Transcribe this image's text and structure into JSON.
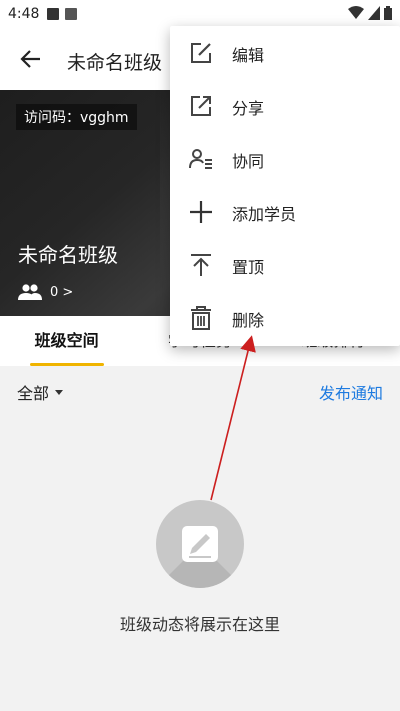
{
  "status_bar": {
    "time": "4:48"
  },
  "header": {
    "title": "未命名班级"
  },
  "banner": {
    "access_code": "访问码：vgghm",
    "class_name": "未命名班级",
    "member_count": "0 >"
  },
  "tabs": [
    {
      "label": "班级空间"
    },
    {
      "label": "学习任务"
    },
    {
      "label": "班级排行"
    }
  ],
  "filter": {
    "selected": "全部",
    "publish_label": "发布通知"
  },
  "empty_state": {
    "text": "班级动态将展示在这里"
  },
  "menu": {
    "items": [
      {
        "label": "编辑",
        "icon": "edit-icon"
      },
      {
        "label": "分享",
        "icon": "share-icon"
      },
      {
        "label": "协同",
        "icon": "collaborate-icon"
      },
      {
        "label": "添加学员",
        "icon": "plus-icon"
      },
      {
        "label": "置顶",
        "icon": "pin-top-icon"
      },
      {
        "label": "删除",
        "icon": "trash-icon"
      }
    ]
  },
  "colors": {
    "accent_tab": "#f0b400",
    "link_blue": "#1e7be0",
    "annotation_red": "#cc1f1f"
  }
}
